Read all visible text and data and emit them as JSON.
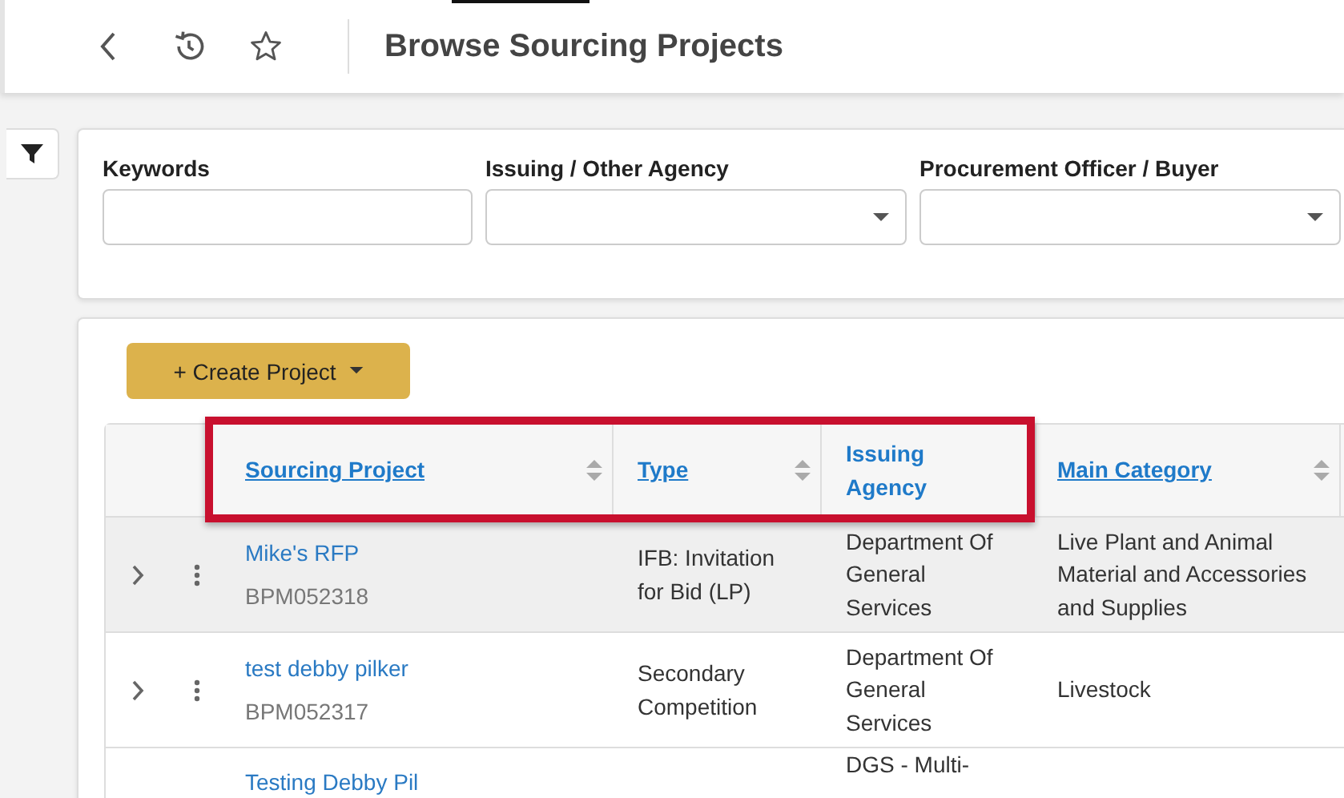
{
  "header": {
    "title": "Browse Sourcing Projects"
  },
  "filters": [
    {
      "label": "Keywords",
      "kind": "text"
    },
    {
      "label": "Issuing / Other Agency",
      "kind": "dropdown"
    },
    {
      "label": "Procurement Officer / Buyer",
      "kind": "dropdown"
    }
  ],
  "create_button": {
    "label": "+ Create Project"
  },
  "table": {
    "columns": [
      {
        "label": "Sourcing Project",
        "sortable": true
      },
      {
        "label": "Type",
        "sortable": true
      },
      {
        "label": "Issuing Agency",
        "sortable": false
      },
      {
        "label": "Main Category",
        "sortable": true
      }
    ],
    "rows": [
      {
        "name": "Mike's RFP",
        "id": "BPM052318",
        "type": "IFB: Invitation for Bid (LP)",
        "agency": "Department Of General Services",
        "category": "Live Plant and Animal Material and Accessories and Supplies",
        "highlighted": true
      },
      {
        "name": "test debby pilker",
        "id": "BPM052317",
        "type": "Secondary Competition",
        "agency": "Department Of General Services",
        "category": "Livestock",
        "highlighted": false
      },
      {
        "name": "Testing Debby Pil",
        "agency": "DGS - Multi-",
        "highlighted": false
      }
    ]
  }
}
